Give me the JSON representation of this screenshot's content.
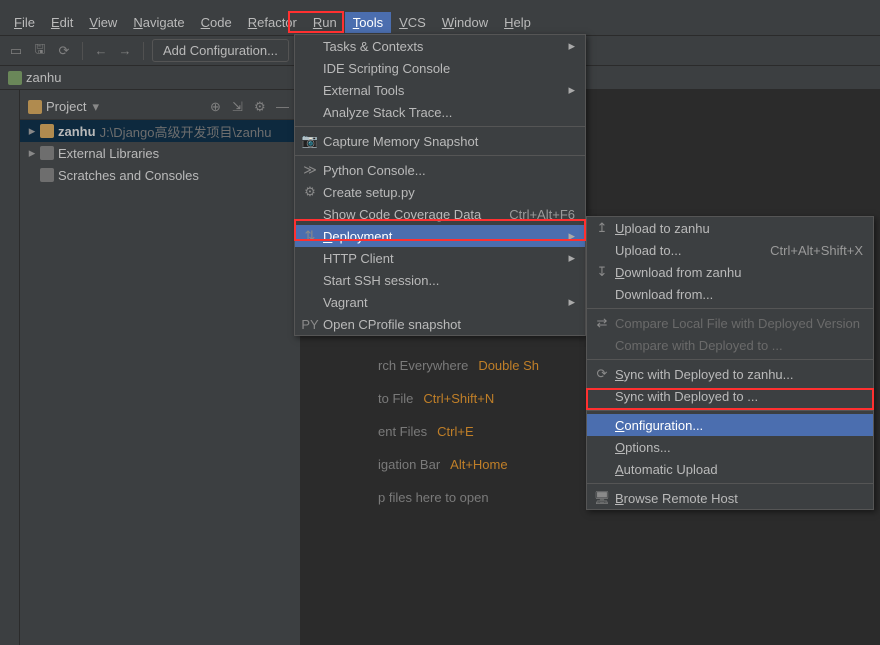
{
  "menubar": [
    "File",
    "Edit",
    "View",
    "Navigate",
    "Code",
    "Refactor",
    "Run",
    "Tools",
    "VCS",
    "Window",
    "Help"
  ],
  "menubar_open_index": 7,
  "toolbar": {
    "add_config_label": "Add Configuration..."
  },
  "breadcrumb": {
    "project": "zanhu"
  },
  "project_panel": {
    "title": "Project",
    "root": {
      "name": "zanhu",
      "path": "J:\\Django高级开发项目\\zanhu"
    },
    "external": "External Libraries",
    "scratches": "Scratches and Consoles"
  },
  "editor_hints": [
    {
      "label": "rch Everywhere",
      "key": "Double Sh"
    },
    {
      "label": "to File",
      "key": "Ctrl+Shift+N"
    },
    {
      "label": "ent Files",
      "key": "Ctrl+E"
    },
    {
      "label": "igation Bar",
      "key": "Alt+Home"
    },
    {
      "label": "p files here to open",
      "key": ""
    }
  ],
  "tools_menu": [
    {
      "label": "Tasks & Contexts",
      "sub": true
    },
    {
      "label": "IDE Scripting Console"
    },
    {
      "label": "External Tools",
      "sub": true
    },
    {
      "label": "Analyze Stack Trace..."
    },
    {
      "sep": true
    },
    {
      "label": "Capture Memory Snapshot",
      "icon": "camera"
    },
    {
      "sep": true
    },
    {
      "label": "Python Console...",
      "icon": "py"
    },
    {
      "label": "Create setup.py",
      "icon": "gear"
    },
    {
      "label": "Show Code Coverage Data",
      "shortcut": "Ctrl+Alt+F6"
    },
    {
      "label": "Deployment",
      "sub": true,
      "hover": true,
      "icon": "updown",
      "mn": "D"
    },
    {
      "label": "HTTP Client",
      "sub": true
    },
    {
      "label": "Start SSH session..."
    },
    {
      "label": "Vagrant",
      "sub": true
    },
    {
      "label": "Open CProfile snapshot",
      "icon": "pyc"
    }
  ],
  "deploy_menu": [
    {
      "label": "Upload to zanhu",
      "icon": "up",
      "mn": "U"
    },
    {
      "label": "Upload to...",
      "shortcut": "Ctrl+Alt+Shift+X"
    },
    {
      "label": "Download from zanhu",
      "icon": "down",
      "mn": "D"
    },
    {
      "label": "Download from..."
    },
    {
      "sep": true
    },
    {
      "label": "Compare Local File with Deployed Version",
      "disabled": true,
      "icon": "diff"
    },
    {
      "label": "Compare with Deployed to ...",
      "disabled": true
    },
    {
      "sep": true
    },
    {
      "label": "Sync with Deployed to zanhu...",
      "icon": "sync",
      "mn": "S"
    },
    {
      "label": "Sync with Deployed to ..."
    },
    {
      "sep": true
    },
    {
      "label": "Configuration...",
      "hover": true,
      "mn": "C"
    },
    {
      "label": "Options...",
      "mn": "O"
    },
    {
      "label": "Automatic Upload",
      "mn": "A"
    },
    {
      "sep": true
    },
    {
      "label": "Browse Remote Host",
      "icon": "globe",
      "mn": "B"
    }
  ]
}
